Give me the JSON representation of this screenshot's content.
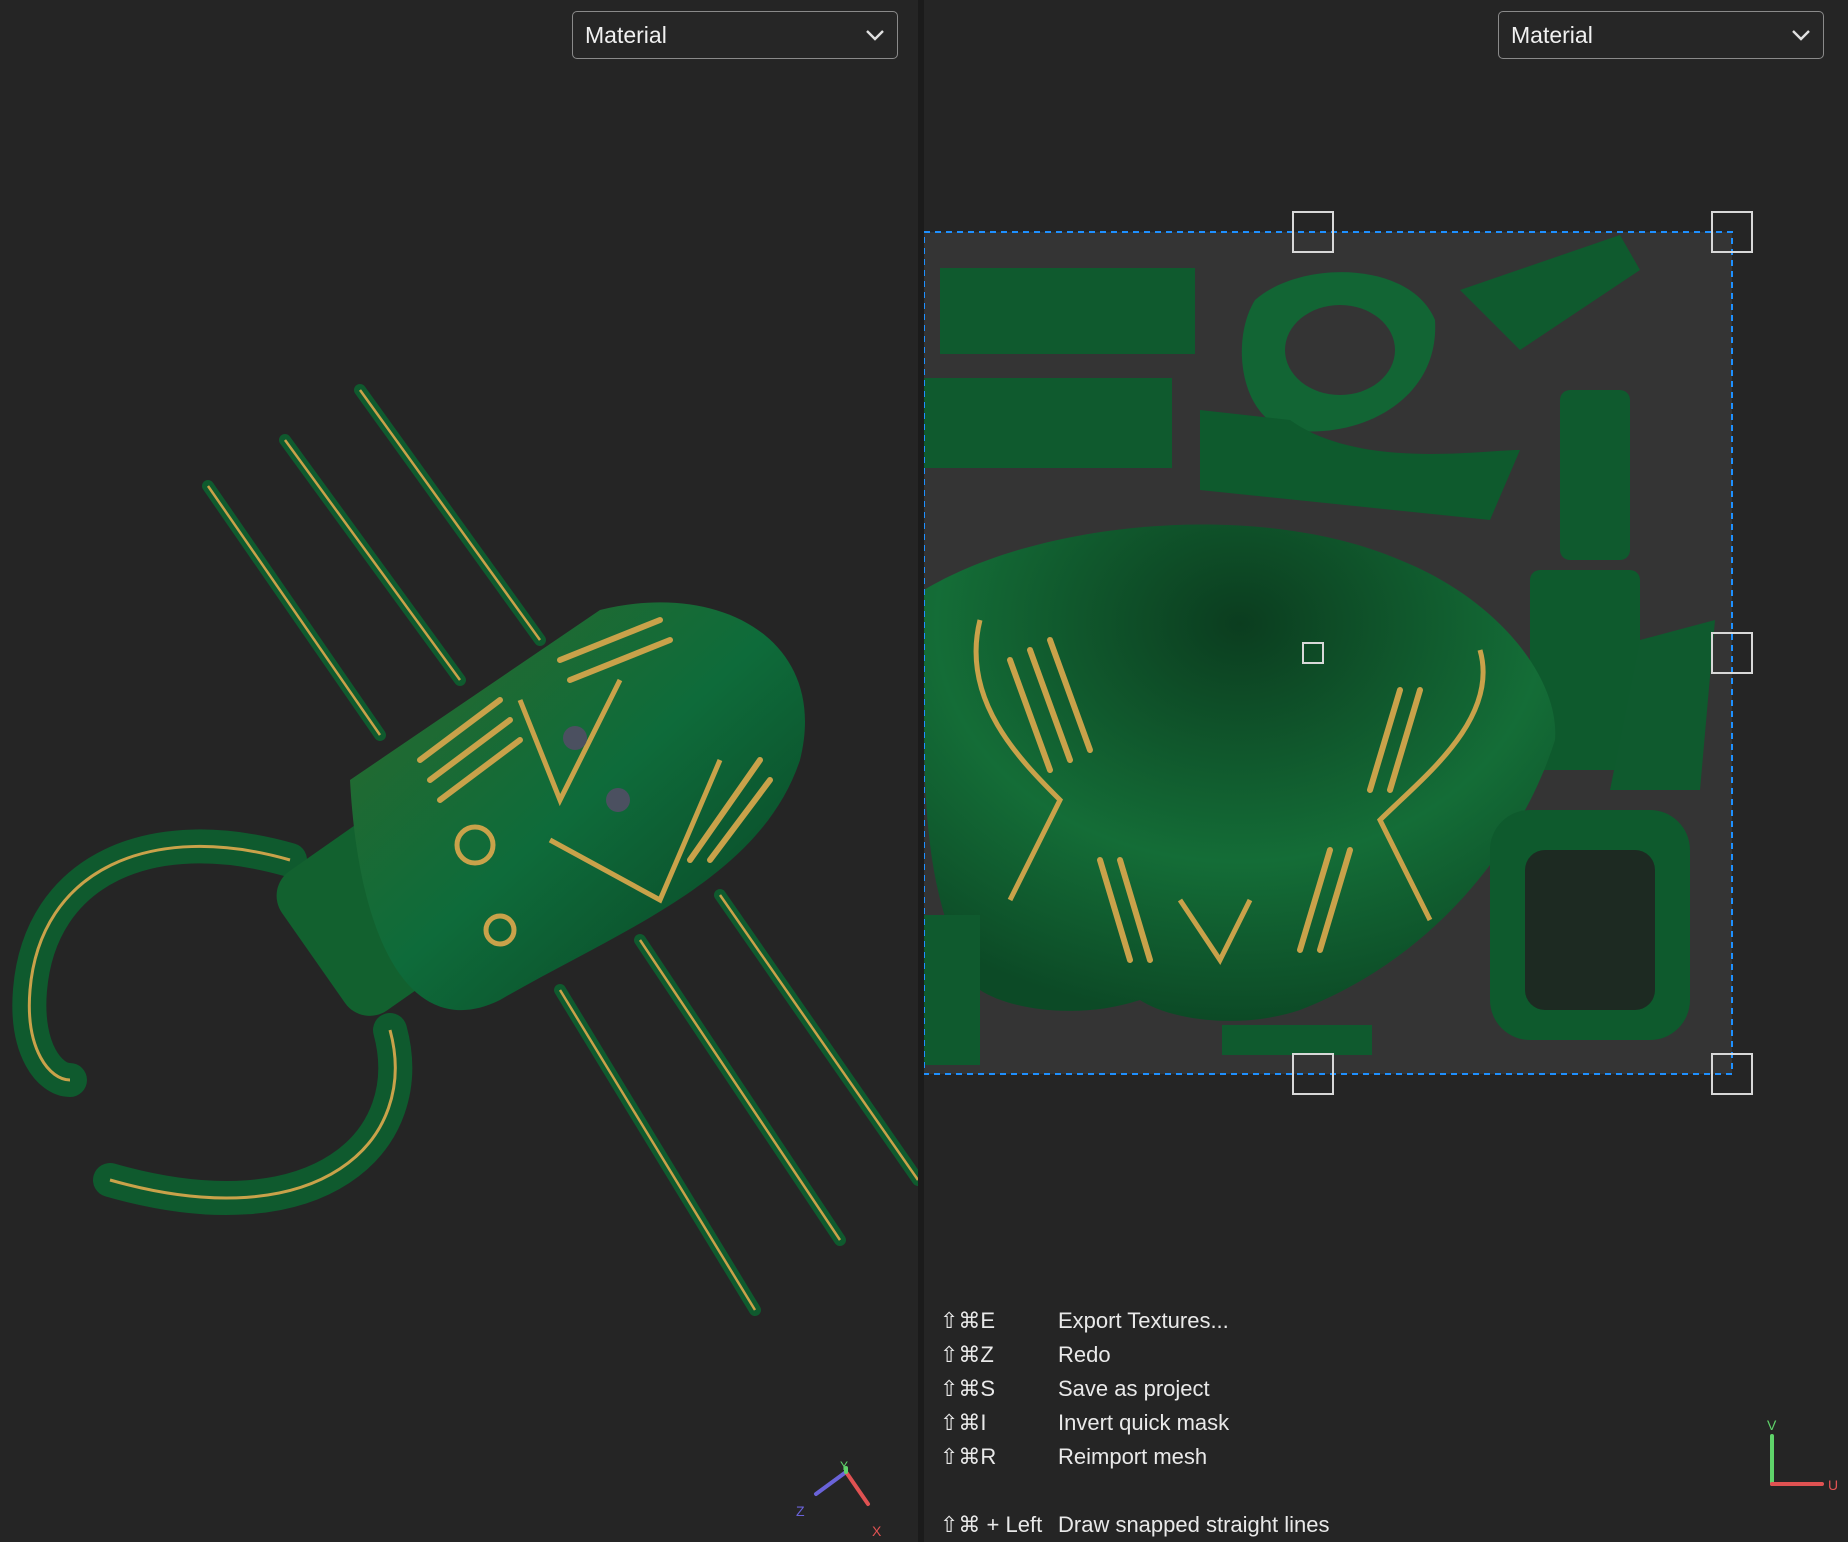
{
  "viewports": {
    "left": {
      "material_select": {
        "value": "Material",
        "icon": "chevron-down-icon"
      }
    },
    "right": {
      "material_select": {
        "value": "Material",
        "icon": "chevron-down-icon"
      }
    }
  },
  "shortcuts": [
    {
      "keys": "⇧⌘E",
      "action": "Export Textures..."
    },
    {
      "keys": "⇧⌘Z",
      "action": "Redo"
    },
    {
      "keys": "⇧⌘S",
      "action": "Save as project"
    },
    {
      "keys": "⇧⌘I",
      "action": "Invert quick mask"
    },
    {
      "keys": "⇧⌘R",
      "action": "Reimport mesh"
    },
    {
      "keys": "⇧⌘ + Left",
      "action": "Draw snapped straight lines"
    }
  ],
  "axis_labels": {
    "gizmo": {
      "z": "Z",
      "y": "Y",
      "x": "X"
    },
    "uv": {
      "v": "V",
      "u": "U"
    }
  },
  "colors": {
    "background": "#252525",
    "mesh_green": "#0f5a2e",
    "trace_gold": "#c9a24a",
    "selection_blue": "#1e90ff"
  }
}
